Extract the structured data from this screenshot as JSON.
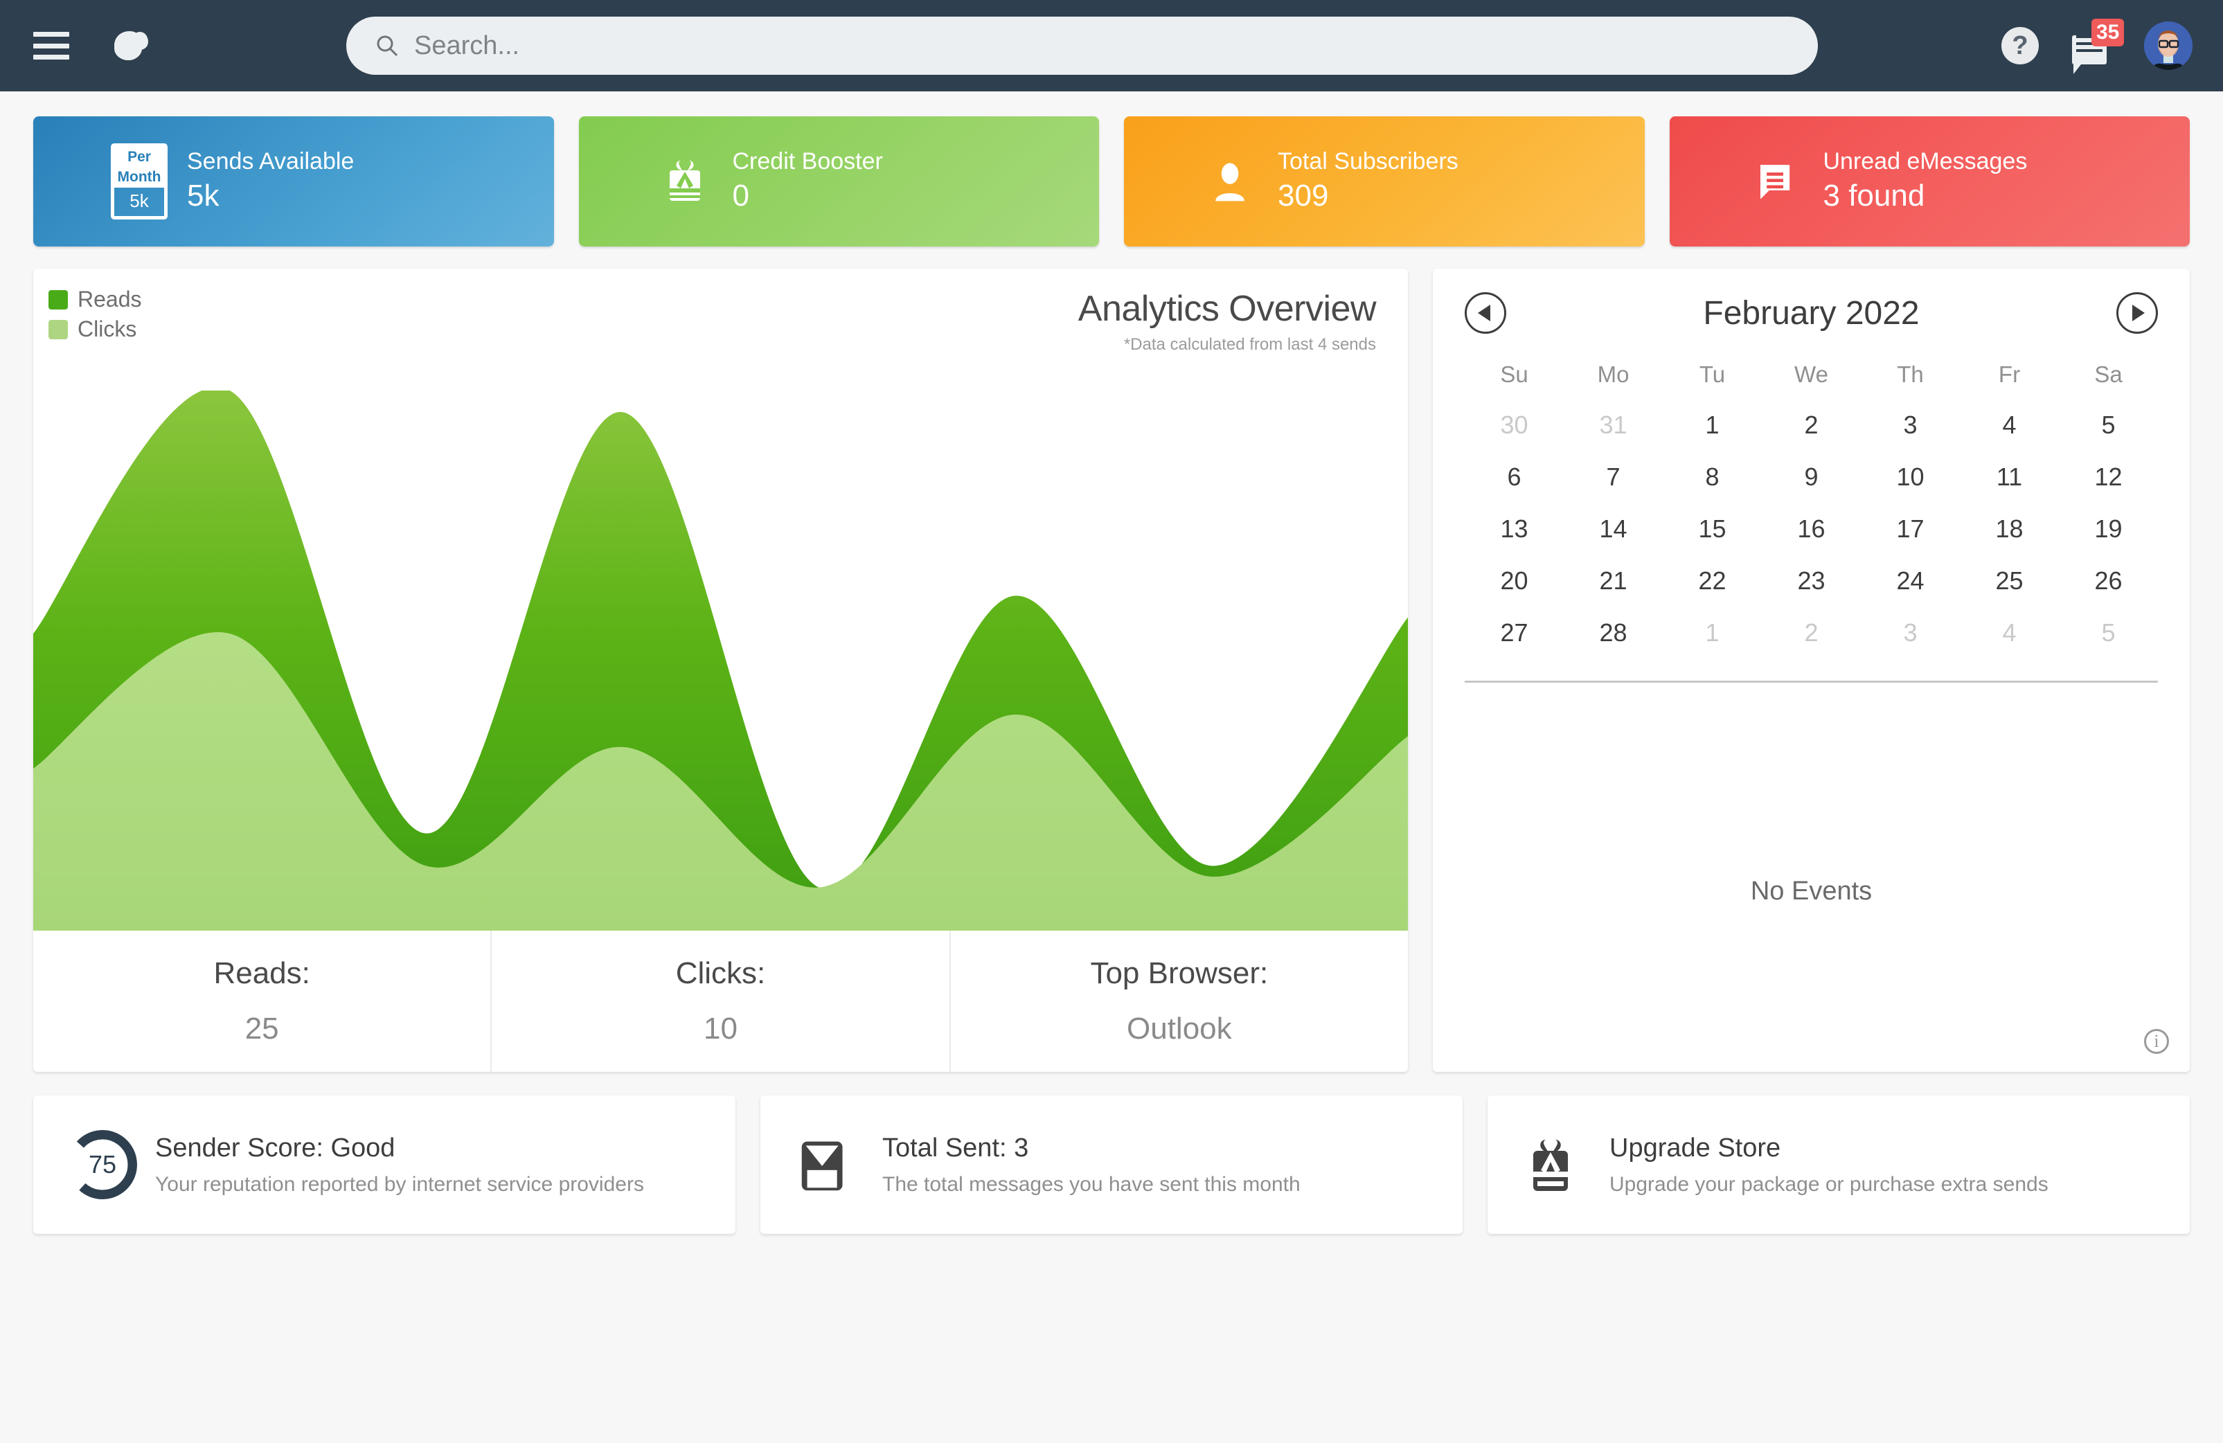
{
  "topbar": {
    "menu_icon": "hamburger-icon",
    "logo_icon": "cloud-logo-icon",
    "search": {
      "placeholder": "Search...",
      "value": "",
      "icon": "search-icon"
    },
    "help_label": "?",
    "messages_badge": "35",
    "avatar_label": "user-avatar"
  },
  "stats": [
    {
      "label": "Sends Available",
      "value": "5k",
      "icon": "per-month-calendar-icon",
      "icon_top": "Per Month",
      "icon_bottom": "5k",
      "color": "#2980b9",
      "theme": "blue"
    },
    {
      "label": "Credit Booster",
      "value": "0",
      "icon": "gift-icon",
      "color": "#83cc4f",
      "theme": "green"
    },
    {
      "label": "Total Subscribers",
      "value": "309",
      "icon": "user-icon",
      "color": "#f9a01b",
      "theme": "orange"
    },
    {
      "label": "Unread eMessages",
      "value": "3 found",
      "icon": "message-icon",
      "color": "#ef4b4b",
      "theme": "red"
    }
  ],
  "analytics": {
    "title": "Analytics Overview",
    "subtitle": "*Data calculated from last 4 sends",
    "legend": [
      {
        "name": "Reads",
        "color": "#4aab18"
      },
      {
        "name": "Clicks",
        "color": "#aed581"
      }
    ],
    "summary": [
      {
        "key": "Reads:",
        "value": "25"
      },
      {
        "key": "Clicks:",
        "value": "10"
      },
      {
        "key": "Top Browser:",
        "value": "Outlook"
      }
    ]
  },
  "chart_data": {
    "type": "area",
    "title": "Analytics Overview",
    "subtitle": "*Data calculated from last 4 sends",
    "xlabel": "",
    "ylabel": "",
    "grid": false,
    "legend_position": "top-left",
    "stacked": false,
    "x": [
      0,
      1,
      2,
      3,
      4,
      5,
      6,
      7
    ],
    "series": [
      {
        "name": "Reads",
        "color": "#4aab18",
        "values": [
          55,
          100,
          18,
          96,
          8,
          62,
          12,
          58
        ]
      },
      {
        "name": "Clicks",
        "color": "#aed581",
        "values": [
          30,
          55,
          12,
          34,
          8,
          40,
          10,
          36
        ]
      }
    ],
    "totals": {
      "reads": 25,
      "clicks": 10,
      "top_browser": "Outlook",
      "sends_analyzed": 4
    }
  },
  "calendar": {
    "month_label": "February 2022",
    "prev_icon": "chevron-left-icon",
    "next_icon": "chevron-right-icon",
    "dow": [
      "Su",
      "Mo",
      "Tu",
      "We",
      "Th",
      "Fr",
      "Sa"
    ],
    "weeks": [
      [
        {
          "d": "30",
          "mute": true
        },
        {
          "d": "31",
          "mute": true
        },
        {
          "d": "1"
        },
        {
          "d": "2"
        },
        {
          "d": "3"
        },
        {
          "d": "4"
        },
        {
          "d": "5"
        }
      ],
      [
        {
          "d": "6"
        },
        {
          "d": "7"
        },
        {
          "d": "8"
        },
        {
          "d": "9"
        },
        {
          "d": "10"
        },
        {
          "d": "11"
        },
        {
          "d": "12"
        }
      ],
      [
        {
          "d": "13"
        },
        {
          "d": "14"
        },
        {
          "d": "15"
        },
        {
          "d": "16"
        },
        {
          "d": "17"
        },
        {
          "d": "18"
        },
        {
          "d": "19"
        }
      ],
      [
        {
          "d": "20"
        },
        {
          "d": "21"
        },
        {
          "d": "22"
        },
        {
          "d": "23"
        },
        {
          "d": "24"
        },
        {
          "d": "25"
        },
        {
          "d": "26"
        }
      ],
      [
        {
          "d": "27"
        },
        {
          "d": "28"
        },
        {
          "d": "1",
          "mute": true
        },
        {
          "d": "2",
          "mute": true
        },
        {
          "d": "3",
          "mute": true
        },
        {
          "d": "4",
          "mute": true
        },
        {
          "d": "5",
          "mute": true
        }
      ]
    ],
    "empty_text": "No Events",
    "info_icon": "info-icon",
    "info_label": "i"
  },
  "bottom": [
    {
      "title": "Sender Score: Good",
      "subtitle": "Your reputation reported by internet service providers",
      "icon": "donut-gauge-icon",
      "score": "75",
      "score_pct": 75,
      "color": "#2e3f4f"
    },
    {
      "title": "Total Sent: 3",
      "subtitle": "The total messages you have sent this month",
      "icon": "envelope-icon"
    },
    {
      "title": "Upgrade Store",
      "subtitle": "Upgrade your package or purchase extra sends",
      "icon": "gift-icon"
    }
  ]
}
